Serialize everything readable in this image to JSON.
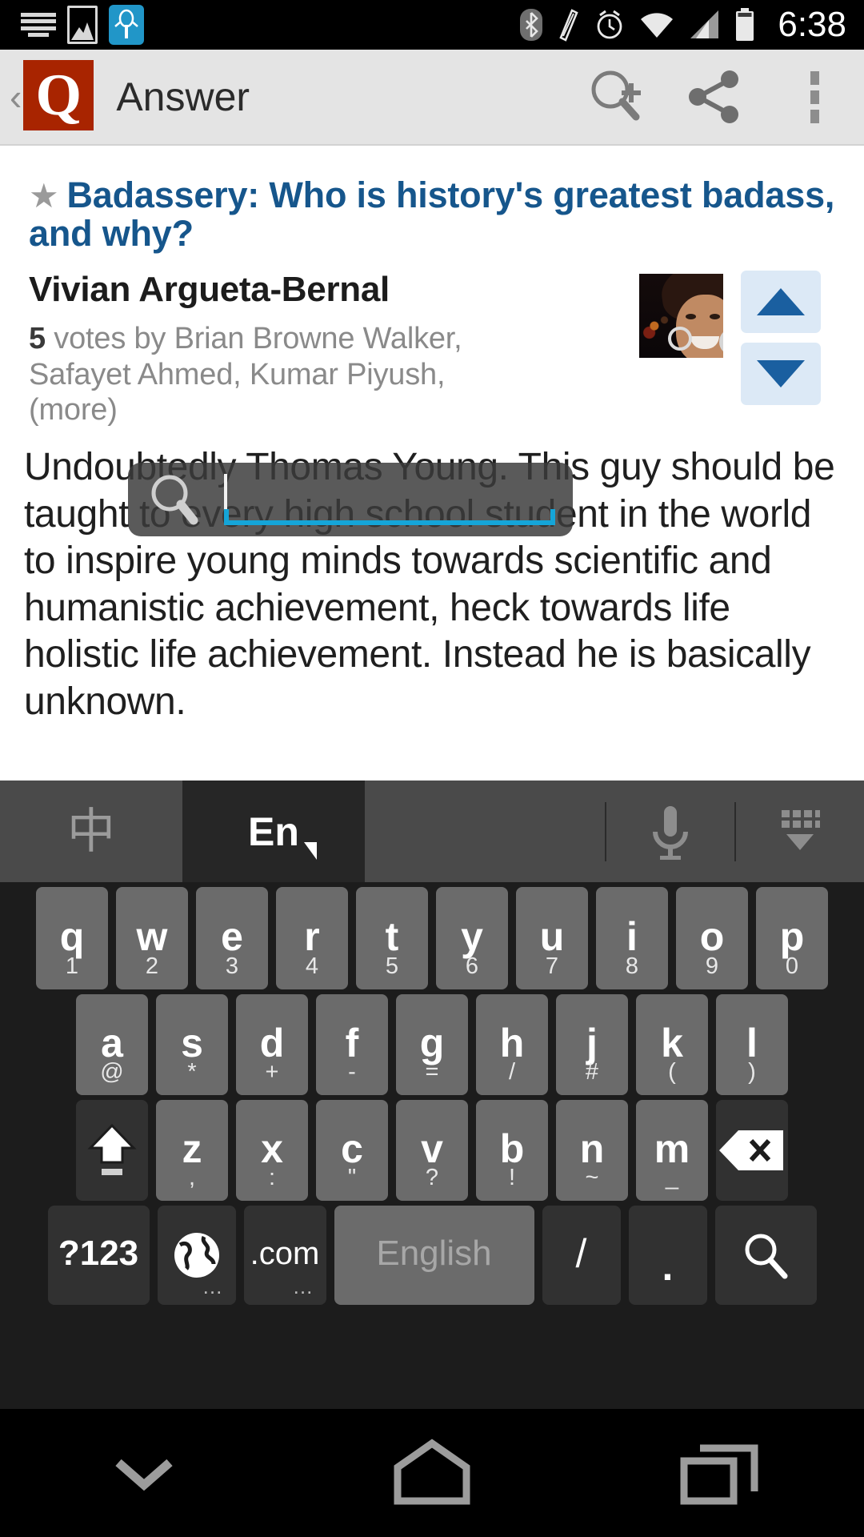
{
  "status_bar": {
    "time": "6:38",
    "left_icons": [
      "keyboard-icon",
      "image-icon",
      "app-notification-icon"
    ],
    "right_icons": [
      "bluetooth-icon",
      "vibrate-icon",
      "alarm-icon",
      "wifi-icon",
      "signal-icon",
      "battery-icon"
    ]
  },
  "app_bar": {
    "back_label": "‹",
    "logo_letter": "Q",
    "title": "Answer",
    "logo_color": "#a82400",
    "actions": [
      "search-plus-icon",
      "share-icon",
      "overflow-menu-icon"
    ]
  },
  "answer": {
    "star": "★",
    "question_title": "Badassery: Who is history's greatest badass, and why?",
    "question_color": "#16568c",
    "author": "Vivian Argueta-Bernal",
    "vote_count": "5",
    "votes_text": " votes by Brian Browne Walker, Safayet Ahmed, Kumar Piyush, (more)",
    "body": "Undoubtedly Thomas Young. This guy should be taught to every high school student in the world to inspire young minds towards scientific and humanistic achievement, heck towards life holistic life achievement.  Instead he is basically unknown.",
    "upvote_icon": "triangle-up-icon",
    "downvote_icon": "triangle-down-icon",
    "vote_button_color": "#dce9f6",
    "vote_arrow_color": "#1a5fa0"
  },
  "search_overlay": {
    "icon": "magnifier-icon",
    "value": "",
    "caret_color": "#f2f2f2",
    "underline_color": "#15a5d8",
    "background": "rgba(58,58,58,0.84)"
  },
  "keyboard": {
    "toolbar": {
      "chinese_label": "中",
      "english_label": "En",
      "mic_icon": "microphone-icon",
      "hide_icon": "hide-keyboard-icon",
      "selected": "En"
    },
    "row1": [
      {
        "main": "q",
        "sub": "1"
      },
      {
        "main": "w",
        "sub": "2"
      },
      {
        "main": "e",
        "sub": "3"
      },
      {
        "main": "r",
        "sub": "4"
      },
      {
        "main": "t",
        "sub": "5"
      },
      {
        "main": "y",
        "sub": "6"
      },
      {
        "main": "u",
        "sub": "7"
      },
      {
        "main": "i",
        "sub": "8"
      },
      {
        "main": "o",
        "sub": "9"
      },
      {
        "main": "p",
        "sub": "0"
      }
    ],
    "row2": [
      {
        "main": "a",
        "sub": "@"
      },
      {
        "main": "s",
        "sub": "*"
      },
      {
        "main": "d",
        "sub": "+"
      },
      {
        "main": "f",
        "sub": "-"
      },
      {
        "main": "g",
        "sub": "="
      },
      {
        "main": "h",
        "sub": "/"
      },
      {
        "main": "j",
        "sub": "#"
      },
      {
        "main": "k",
        "sub": "("
      },
      {
        "main": "l",
        "sub": ")"
      }
    ],
    "row3": {
      "shift_icon": "shift-icon",
      "keys": [
        {
          "main": "z",
          "sub": ","
        },
        {
          "main": "x",
          "sub": ":"
        },
        {
          "main": "c",
          "sub": "\""
        },
        {
          "main": "v",
          "sub": "?"
        },
        {
          "main": "b",
          "sub": "!"
        },
        {
          "main": "n",
          "sub": "~"
        },
        {
          "main": "m",
          "sub": "_"
        }
      ],
      "delete_icon": "backspace-icon"
    },
    "row4": {
      "symbols_label": "?123",
      "globe_icon": "globe-icon",
      "globe_sub": "…",
      "com_label": ".com",
      "com_sub": "…",
      "space_label": "English",
      "slash_label": "/",
      "period_label": ".",
      "search_icon": "search-icon"
    }
  },
  "nav_bar": {
    "back_icon": "chevron-down-icon",
    "home_icon": "home-icon",
    "recents_icon": "recents-icon"
  }
}
